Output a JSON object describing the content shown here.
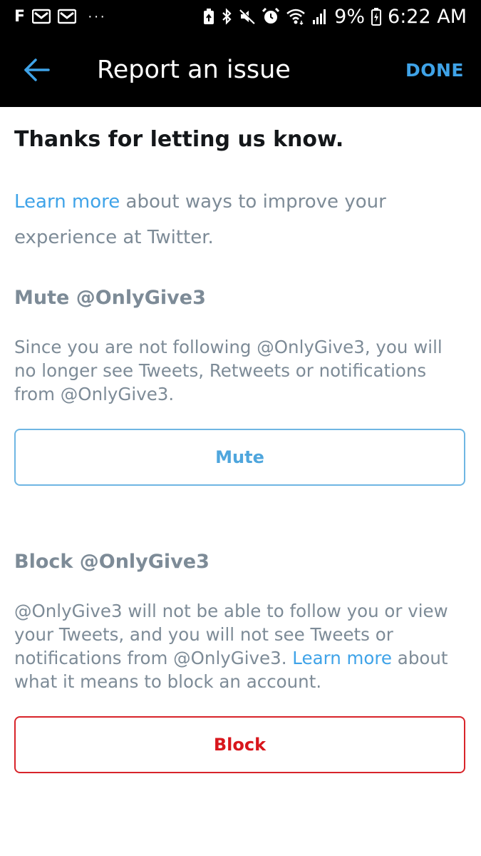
{
  "status_bar": {
    "app_letter": "F",
    "overflow": "···",
    "battery_percent": "9%",
    "time": "6:22 AM",
    "icons": [
      "facebook-notification-icon",
      "gmail-icon",
      "gmail-icon",
      "battery-saver-icon",
      "bluetooth-icon",
      "mute-icon",
      "alarm-icon",
      "wifi-icon",
      "signal-icon",
      "battery-icon"
    ]
  },
  "header": {
    "title": "Report an issue",
    "done_label": "DONE",
    "back_icon": "arrow-left-icon"
  },
  "main": {
    "heading": "Thanks for letting us know.",
    "intro_link": "Learn more",
    "intro_text": " about ways to improve your experience at Twitter.",
    "mute": {
      "title": "Mute @OnlyGive3",
      "description": "Since you are not following @OnlyGive3, you will no longer see Tweets, Retweets or notifications from @OnlyGive3.",
      "button_label": "Mute"
    },
    "block": {
      "title": "Block @OnlyGive3",
      "description_before": "@OnlyGive3 will not be able to follow you or view your Tweets, and you will not see Tweets or notifications from @OnlyGive3. ",
      "description_link": "Learn more",
      "description_after": " about what it means to block an account.",
      "button_label": "Block"
    }
  },
  "colors": {
    "accent_blue": "#3fa3e8",
    "block_red": "#d8161c",
    "muted_text": "#7d8b97",
    "heading_text": "#14171a",
    "bar_background": "#000000"
  }
}
